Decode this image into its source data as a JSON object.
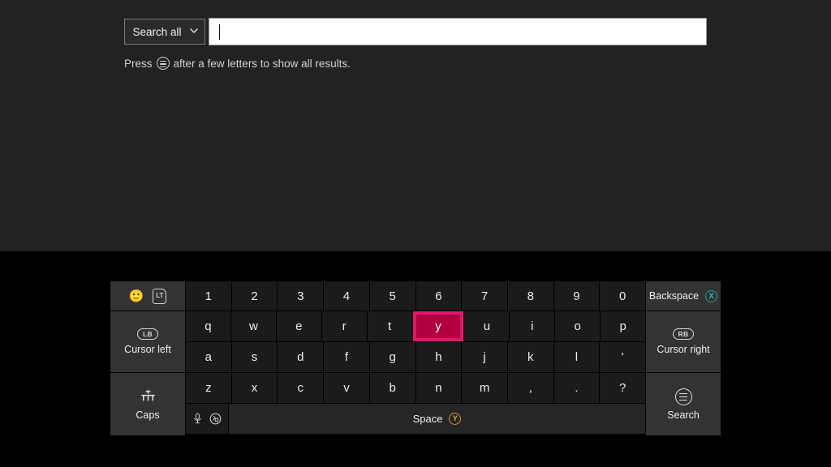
{
  "search": {
    "scope_label": "Search all",
    "scope_icon": "chevron-down-icon",
    "input_value": "",
    "input_placeholder": "",
    "hint_prefix": "Press",
    "hint_icon": "menu-icon",
    "hint_suffix": "after a few letters to show all results."
  },
  "keyboard": {
    "rows": {
      "numbers": [
        "1",
        "2",
        "3",
        "4",
        "5",
        "6",
        "7",
        "8",
        "9",
        "0"
      ],
      "top": [
        "q",
        "w",
        "e",
        "r",
        "t",
        "y",
        "u",
        "i",
        "o",
        "p"
      ],
      "home": [
        "a",
        "s",
        "d",
        "f",
        "g",
        "h",
        "j",
        "k",
        "l",
        "'"
      ],
      "bottom": [
        "z",
        "x",
        "c",
        "v",
        "b",
        "n",
        "m",
        ",",
        ".",
        "?"
      ]
    },
    "selected_key": "y",
    "space": {
      "label": "Space",
      "button_glyph": "Y",
      "button_name": "y-button-icon"
    },
    "fn": {
      "mic_icon": "microphone-icon",
      "symbols_icon": "symbols-icon"
    }
  },
  "left_panel": {
    "emoji": {
      "emoji_glyph": "🙂",
      "emoji_icon": "emoji-smiley-icon",
      "trigger_glyph": "LT",
      "trigger_icon": "lt-trigger-icon"
    },
    "cursor_left": {
      "label": "Cursor left",
      "button_glyph": "LB",
      "button_icon": "lb-bumper-icon"
    },
    "caps": {
      "label": "Caps",
      "icon": "caps-shift-icon"
    }
  },
  "right_panel": {
    "backspace": {
      "label": "Backspace",
      "button_glyph": "X",
      "button_icon": "x-button-icon"
    },
    "cursor_right": {
      "label": "Cursor right",
      "button_glyph": "RB",
      "button_icon": "rb-bumper-icon"
    },
    "search": {
      "label": "Search",
      "icon": "menu-icon"
    }
  },
  "colors": {
    "top_background": "#222222",
    "keyboard_background": "#000000",
    "key_background": "#1b1b1b",
    "side_key_background": "#333333",
    "selected_key_fill": "#b0003f",
    "selected_key_border": "#e3176b",
    "x_button": "#34b8b8",
    "y_button": "#e0ac36",
    "input_background": "#ffffff"
  }
}
